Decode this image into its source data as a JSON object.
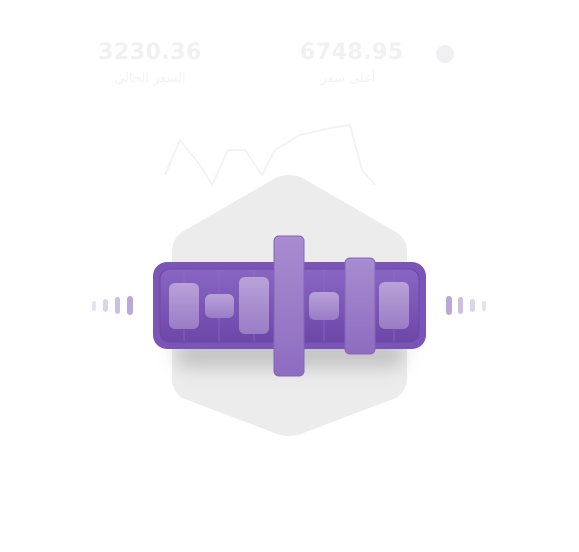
{
  "stats": [
    {
      "value": "3230.36",
      "label": "السعر الحالي"
    },
    {
      "value": "6748.95",
      "label": "أعلى سعر"
    }
  ],
  "colors": {
    "accent": "#7b55b5",
    "accent_dark": "#5f3d94",
    "accent_light": "#a58ac9",
    "hexagon": "#ececec",
    "ghost_text": "#f1f1f3"
  },
  "icons": {
    "status_dot": "circle-dot-icon",
    "illustration": "candlestick-bar-icon"
  }
}
